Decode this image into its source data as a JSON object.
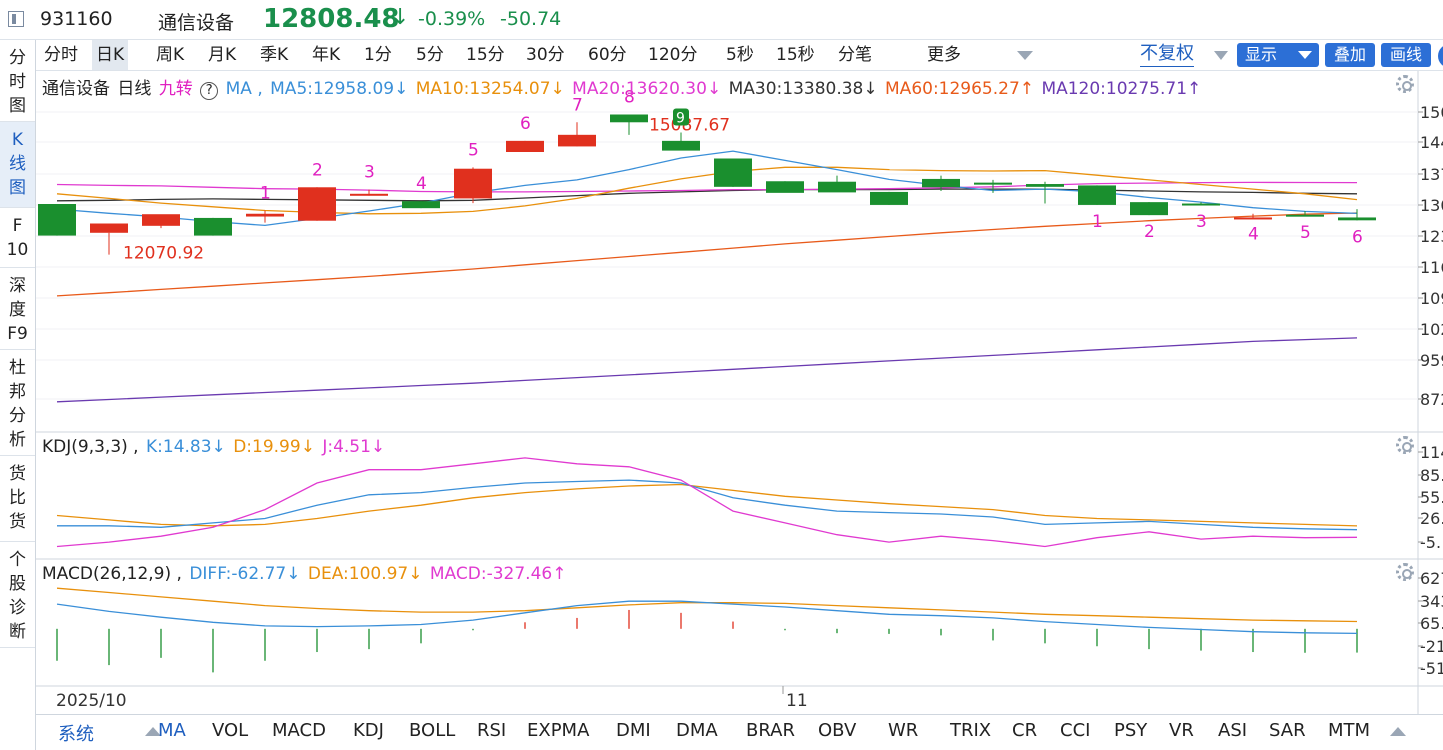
{
  "header": {
    "code": "931160",
    "name": "通信设备",
    "price": "12808.48",
    "arrow": "↓",
    "change_pct": "-0.39%",
    "change": "-50.74"
  },
  "sidebar": [
    "分时图",
    "K线图",
    "F10",
    "深度F9",
    "杜邦分析",
    "货比货",
    "个股诊断"
  ],
  "periods": [
    "分时",
    "日K",
    "周K",
    "月K",
    "季K",
    "年K",
    "1分",
    "5分",
    "15分",
    "30分",
    "60分",
    "120分",
    "5秒",
    "15秒",
    "分笔",
    "更多"
  ],
  "active_period": "日K",
  "toolbar": {
    "fuquan": "不复权",
    "show": "显示",
    "overlay": "叠加",
    "draw": "画线"
  },
  "kline_legend": {
    "name": "通信设备",
    "period": "日线",
    "jiuzhuan": "九转",
    "help": "?",
    "ma_label": "MA ,",
    "ma5": "MA5:12958.09↓",
    "ma10": "MA10:13254.07↓",
    "ma20": "MA20:13620.30↓",
    "ma30": "MA30:13380.38↓",
    "ma60": "MA60:12965.27↑",
    "ma120": "MA120:10275.71↑"
  },
  "kdj_legend": {
    "label": "KDJ(9,3,3) ,",
    "k": "K:14.83↓",
    "d": "D:19.99↓",
    "j": "J:4.51↓"
  },
  "macd_legend": {
    "label": "MACD(26,12,9) ,",
    "diff": "DIFF:-62.77↓",
    "dea": "DEA:100.97↓",
    "macd": "MACD:-327.46↑"
  },
  "kline_axis": [
    "150",
    "144",
    "137",
    "130",
    "123",
    "116",
    "109",
    "102",
    "959",
    "872"
  ],
  "kdj_axis": [
    "114",
    "85.",
    "55.",
    "26.",
    "-5."
  ],
  "macd_axis": [
    "627",
    "343",
    "65.",
    "-21",
    "-51"
  ],
  "price_labels": {
    "low": "12070.92",
    "high": "15087.67"
  },
  "nine_turn_up": [
    "1",
    "2",
    "3",
    "4",
    "5",
    "6",
    "7",
    "8",
    "9"
  ],
  "nine_turn_down": [
    "1",
    "2",
    "3",
    "4",
    "5",
    "6"
  ],
  "date_axis": [
    "2025/10",
    "11"
  ],
  "bottom_tabs": [
    "系统",
    "MA",
    "VOL",
    "MACD",
    "KDJ",
    "BOLL",
    "RSI",
    "EXPMA",
    "DMI",
    "DMA",
    "BRAR",
    "OBV",
    "WR",
    "TRIX",
    "CR",
    "CCI",
    "PSY",
    "VR",
    "ASI",
    "SAR",
    "MTM"
  ],
  "active_bottom_tab": "MA",
  "colors": {
    "up": "#e0301e",
    "down": "#1a8f2e",
    "ma5": "#3a8fd8",
    "ma10": "#e8900c",
    "ma20": "#e03ad0",
    "ma30": "#333333",
    "ma60": "#e85a1a",
    "ma120": "#6a3ab0",
    "k": "#3a8fd8",
    "d": "#e8900c",
    "j": "#e03ad0",
    "nine_turn": "#e020c0"
  },
  "chart_data": {
    "type": "candlestick",
    "dates": [
      "2025/10",
      "11"
    ],
    "candles": [
      {
        "o": 13160,
        "h": 13160,
        "l": 12480,
        "c": 12480
      },
      {
        "o": 12540,
        "h": 12540,
        "l": 12070.92,
        "c": 12740
      },
      {
        "o": 12690,
        "h": 12880,
        "l": 12640,
        "c": 12940
      },
      {
        "o": 12860,
        "h": 12860,
        "l": 12480,
        "c": 12480
      },
      {
        "o": 12890,
        "h": 13020,
        "l": 12760,
        "c": 12950
      },
      {
        "o": 12800,
        "h": 13520,
        "l": 12800,
        "c": 13520
      },
      {
        "o": 13360,
        "h": 13470,
        "l": 13340,
        "c": 13380
      },
      {
        "o": 13220,
        "h": 13220,
        "l": 13070,
        "c": 13070
      },
      {
        "o": 13280,
        "h": 13950,
        "l": 13180,
        "c": 13920
      },
      {
        "o": 14280,
        "h": 14520,
        "l": 14280,
        "c": 14520
      },
      {
        "o": 14400,
        "h": 14920,
        "l": 14400,
        "c": 14650
      },
      {
        "o": 15087.67,
        "h": 15087.67,
        "l": 14650,
        "c": 14920
      },
      {
        "o": 14520,
        "h": 14700,
        "l": 14340,
        "c": 14310
      },
      {
        "o": 14140,
        "h": 14140,
        "l": 13530,
        "c": 13530
      },
      {
        "o": 13650,
        "h": 13650,
        "l": 13450,
        "c": 13400
      },
      {
        "o": 13640,
        "h": 13770,
        "l": 13460,
        "c": 13410
      },
      {
        "o": 13420,
        "h": 13420,
        "l": 13140,
        "c": 13140
      },
      {
        "o": 13700,
        "h": 13770,
        "l": 13440,
        "c": 13520
      },
      {
        "o": 13620,
        "h": 13680,
        "l": 13400,
        "c": 13600
      },
      {
        "o": 13590,
        "h": 13640,
        "l": 13170,
        "c": 13530
      },
      {
        "o": 13560,
        "h": 13560,
        "l": 13140,
        "c": 13140
      },
      {
        "o": 13200,
        "h": 13200,
        "l": 12920,
        "c": 12920
      },
      {
        "o": 13170,
        "h": 13200,
        "l": 13140,
        "c": 13160
      },
      {
        "o": 12870,
        "h": 12950,
        "l": 12870,
        "c": 12870
      },
      {
        "o": 12930,
        "h": 13010,
        "l": 12900,
        "c": 12900
      },
      {
        "o": 12870,
        "h": 13050,
        "l": 12808.48,
        "c": 12808.48
      }
    ],
    "nine_turn_up_index": [
      4,
      5,
      6,
      7,
      8,
      9,
      10,
      11,
      12
    ],
    "nine_turn_down_index": [
      20,
      21,
      22,
      23,
      24,
      25
    ],
    "ma5": [
      13050,
      12960,
      12880,
      12780,
      12700,
      12850,
      13010,
      13180,
      13400,
      13560,
      13680,
      13900,
      14150,
      14300,
      14100,
      13900,
      13690,
      13560,
      13450,
      13480,
      13420,
      13300,
      13200,
      13080,
      13000,
      12958.09
    ],
    "ma10": [
      13380,
      13280,
      13180,
      13100,
      13020,
      12980,
      12950,
      12960,
      13000,
      13120,
      13280,
      13500,
      13700,
      13860,
      13950,
      13950,
      13900,
      13880,
      13870,
      13880,
      13780,
      13680,
      13580,
      13480,
      13380,
      13254.07
    ],
    "ma20": [
      13580,
      13560,
      13550,
      13520,
      13490,
      13480,
      13460,
      13430,
      13420,
      13420,
      13430,
      13440,
      13450,
      13470,
      13470,
      13480,
      13490,
      13510,
      13530,
      13570,
      13600,
      13610,
      13620,
      13625,
      13624,
      13620.3
    ],
    "ma30": [
      13230,
      13240,
      13260,
      13270,
      13260,
      13250,
      13240,
      13230,
      13240,
      13290,
      13340,
      13390,
      13420,
      13450,
      13470,
      13470,
      13470,
      13480,
      13480,
      13480,
      13460,
      13440,
      13420,
      13410,
      13390,
      13380.38
    ],
    "ma60": [
      11180,
      11250,
      11320,
      11390,
      11460,
      11530,
      11600,
      11680,
      11760,
      11850,
      11940,
      12030,
      12120,
      12210,
      12300,
      12380,
      12460,
      12540,
      12610,
      12680,
      12740,
      12800,
      12850,
      12900,
      12940,
      12965.27
    ],
    "ma120": [
      8900,
      8950,
      9000,
      9050,
      9100,
      9150,
      9200,
      9250,
      9300,
      9360,
      9420,
      9480,
      9540,
      9600,
      9660,
      9720,
      9780,
      9840,
      9900,
      9960,
      10020,
      10080,
      10140,
      10200,
      10240,
      10275.71
    ],
    "kline_ylim": [
      8400,
      15400
    ],
    "kdj": {
      "k": [
        20,
        20,
        18,
        24,
        30,
        48,
        62,
        65,
        72,
        78,
        80,
        82,
        78,
        58,
        48,
        40,
        38,
        36,
        32,
        22,
        24,
        26,
        22,
        18,
        16,
        14.83
      ],
      "d": [
        34,
        28,
        22,
        20,
        22,
        30,
        40,
        48,
        58,
        65,
        70,
        74,
        76,
        68,
        60,
        55,
        50,
        46,
        42,
        34,
        30,
        28,
        26,
        24,
        22,
        19.99
      ],
      "j": [
        -8,
        -2,
        6,
        18,
        42,
        78,
        96,
        96,
        104,
        112,
        104,
        100,
        82,
        40,
        24,
        8,
        -2,
        6,
        0,
        -8,
        4,
        12,
        2,
        6,
        4,
        4.51
      ],
      "ylim": [
        -10,
        120
      ]
    },
    "macd": {
      "diff": [
        340,
        240,
        160,
        90,
        40,
        30,
        40,
        60,
        120,
        220,
        320,
        380,
        380,
        340,
        300,
        250,
        200,
        180,
        150,
        100,
        60,
        20,
        -10,
        -40,
        -55,
        -62.77
      ],
      "dea": [
        560,
        500,
        440,
        380,
        320,
        280,
        250,
        230,
        230,
        250,
        290,
        330,
        360,
        360,
        350,
        320,
        290,
        260,
        230,
        200,
        180,
        160,
        140,
        120,
        110,
        100.97
      ],
      "bar": [
        -440,
        -500,
        -400,
        -600,
        -440,
        -320,
        -280,
        -200,
        -20,
        90,
        150,
        260,
        220,
        100,
        -20,
        -60,
        -70,
        -90,
        -160,
        -200,
        -240,
        -280,
        -300,
        -320,
        -330,
        -327.46
      ],
      "ylim": [
        -650,
        700
      ]
    }
  }
}
